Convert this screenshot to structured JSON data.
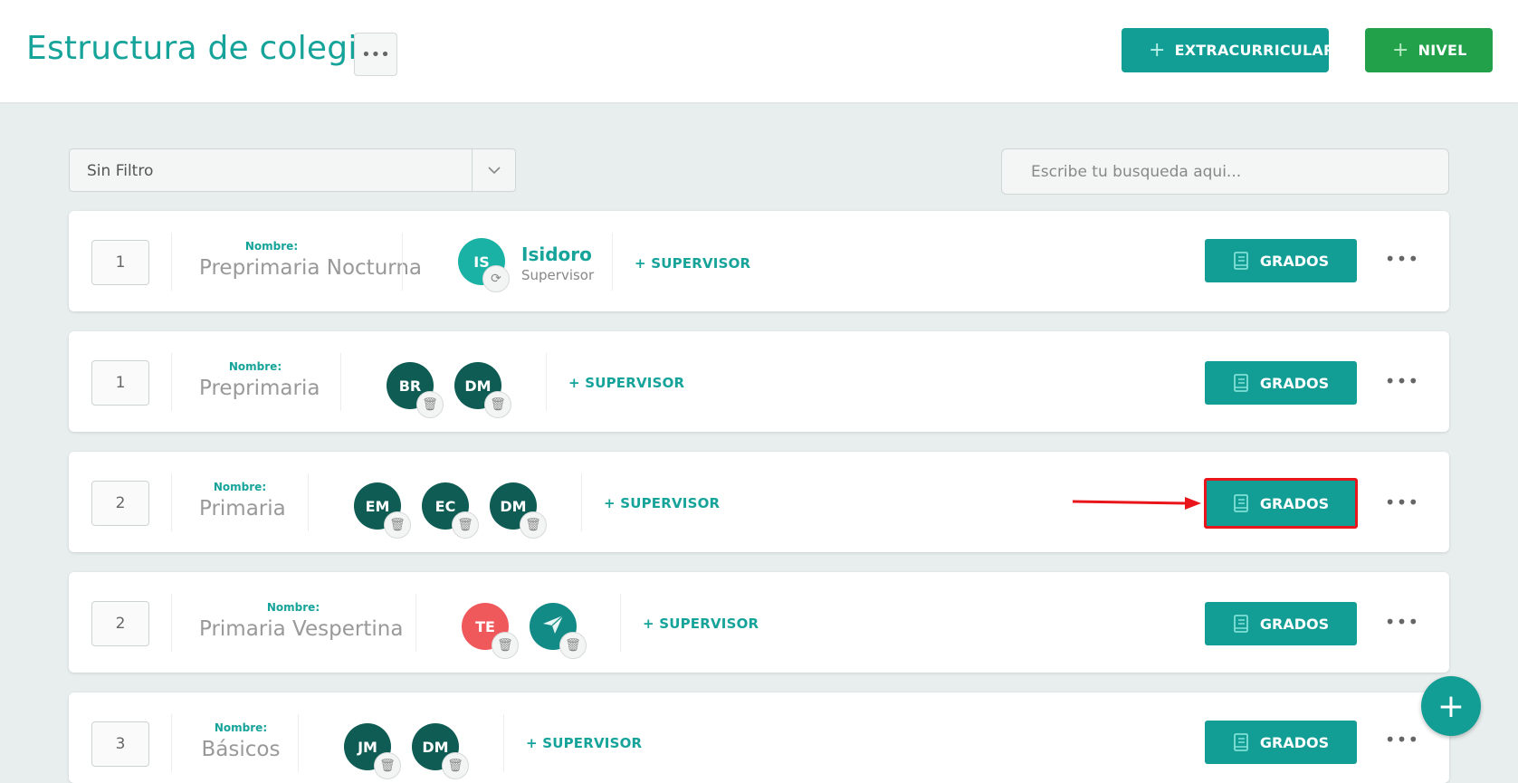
{
  "header": {
    "title": "Estructura de colegio",
    "menu_icon": "ellipsis-icon",
    "btn_extracurricular": "EXTRACURRICULAR",
    "btn_nivel": "NIVEL",
    "plus": "+"
  },
  "filter": {
    "value": "Sin Filtro"
  },
  "search": {
    "placeholder": "Escribe tu busqueda aqui..."
  },
  "common": {
    "name_label": "Nombre:",
    "add_supervisor": "SUPERVISOR",
    "grados": "GRADOS"
  },
  "levels": [
    {
      "order": "1",
      "name": "Preprimaria Nocturna",
      "supervisor": {
        "initials": "IS",
        "name": "Isidoro",
        "role": "Supervisor"
      }
    },
    {
      "order": "1",
      "name": "Preprimaria",
      "avatars": [
        "BR",
        "DM"
      ]
    },
    {
      "order": "2",
      "name": "Primaria",
      "avatars": [
        "EM",
        "EC",
        "DM"
      ]
    },
    {
      "order": "2",
      "name": "Primaria Vespertina",
      "avatars": [
        "TE",
        ""
      ]
    },
    {
      "order": "3",
      "name": "Básicos",
      "avatars": [
        "JM",
        "DM"
      ]
    }
  ],
  "colors": {
    "accent": "#129d95",
    "green": "#22a04a",
    "highlight": "#e8161b",
    "avatar_dark": "#0f5c55"
  },
  "fab": {
    "label": "+"
  }
}
